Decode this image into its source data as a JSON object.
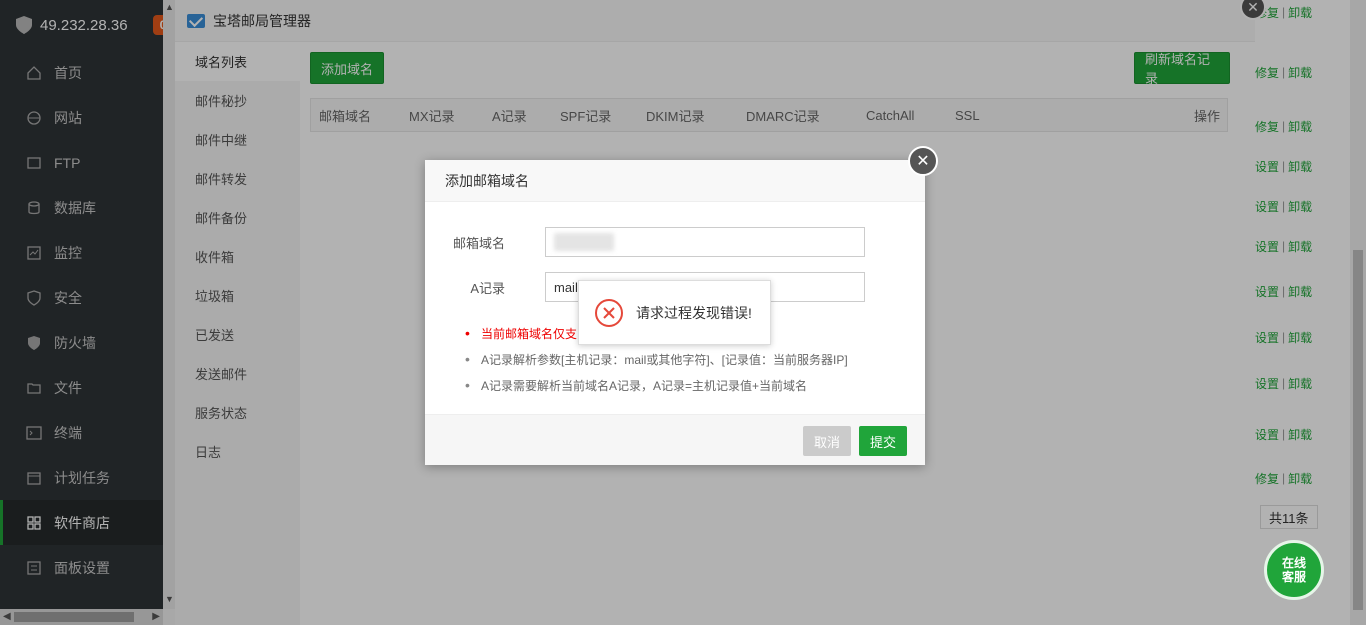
{
  "sidebar": {
    "ip": "49.232.28.36",
    "badge": "0",
    "items": [
      {
        "label": "首页",
        "icon": "home-icon"
      },
      {
        "label": "网站",
        "icon": "globe-icon"
      },
      {
        "label": "FTP",
        "icon": "ftp-icon"
      },
      {
        "label": "数据库",
        "icon": "database-icon"
      },
      {
        "label": "监控",
        "icon": "monitor-icon"
      },
      {
        "label": "安全",
        "icon": "shield-check-icon"
      },
      {
        "label": "防火墙",
        "icon": "firewall-icon"
      },
      {
        "label": "文件",
        "icon": "folder-icon"
      },
      {
        "label": "终端",
        "icon": "terminal-icon"
      },
      {
        "label": "计划任务",
        "icon": "calendar-icon"
      },
      {
        "label": "软件商店",
        "icon": "apps-grid-icon"
      },
      {
        "label": "面板设置",
        "icon": "settings-icon"
      }
    ],
    "active_index": 10
  },
  "background": {
    "row_actions": [
      {
        "link1": "修复",
        "link2": "卸载"
      },
      {
        "link1": "修复",
        "link2": "卸载"
      },
      {
        "link1": "修复",
        "link2": "卸载"
      },
      {
        "link1": "设置",
        "link2": "卸载"
      },
      {
        "link1": "设置",
        "link2": "卸载"
      },
      {
        "link1": "设置",
        "link2": "卸载"
      },
      {
        "link1": "设置",
        "link2": "卸载"
      },
      {
        "link1": "设置",
        "link2": "卸载"
      },
      {
        "link1": "设置",
        "link2": "卸载"
      },
      {
        "link1": "设置",
        "link2": "卸载"
      },
      {
        "link1": "修复",
        "link2": "卸载"
      }
    ],
    "total": "共11条",
    "chat_label_1": "在线",
    "chat_label_2": "客服"
  },
  "mail_window": {
    "title": "宝塔邮局管理器",
    "menu": [
      "域名列表",
      "邮件秘抄",
      "邮件中继",
      "邮件转发",
      "邮件备份",
      "收件箱",
      "垃圾箱",
      "已发送",
      "发送邮件",
      "服务状态",
      "日志"
    ],
    "add_domain_button": "添加域名",
    "refresh_button": "刷新域名记录",
    "table_headers": [
      "邮箱域名",
      "MX记录",
      "A记录",
      "SPF记录",
      "DKIM记录",
      "DMARC记录",
      "CatchAll",
      "SSL",
      "操作"
    ]
  },
  "dialog": {
    "title": "添加邮箱域名",
    "domain_label": "邮箱域名",
    "a_record_label": "A记录",
    "a_record_value": "mail",
    "notes": [
      "当前邮箱域名仅支",
      "A记录解析参数[主机记录：mail或其他字符]、[记录值：当前服务器IP]",
      "A记录需要解析当前域名A记录，A记录=主机记录值+当前域名"
    ],
    "cancel": "取消",
    "submit": "提交"
  },
  "toast": {
    "message": "请求过程发现错误!"
  }
}
